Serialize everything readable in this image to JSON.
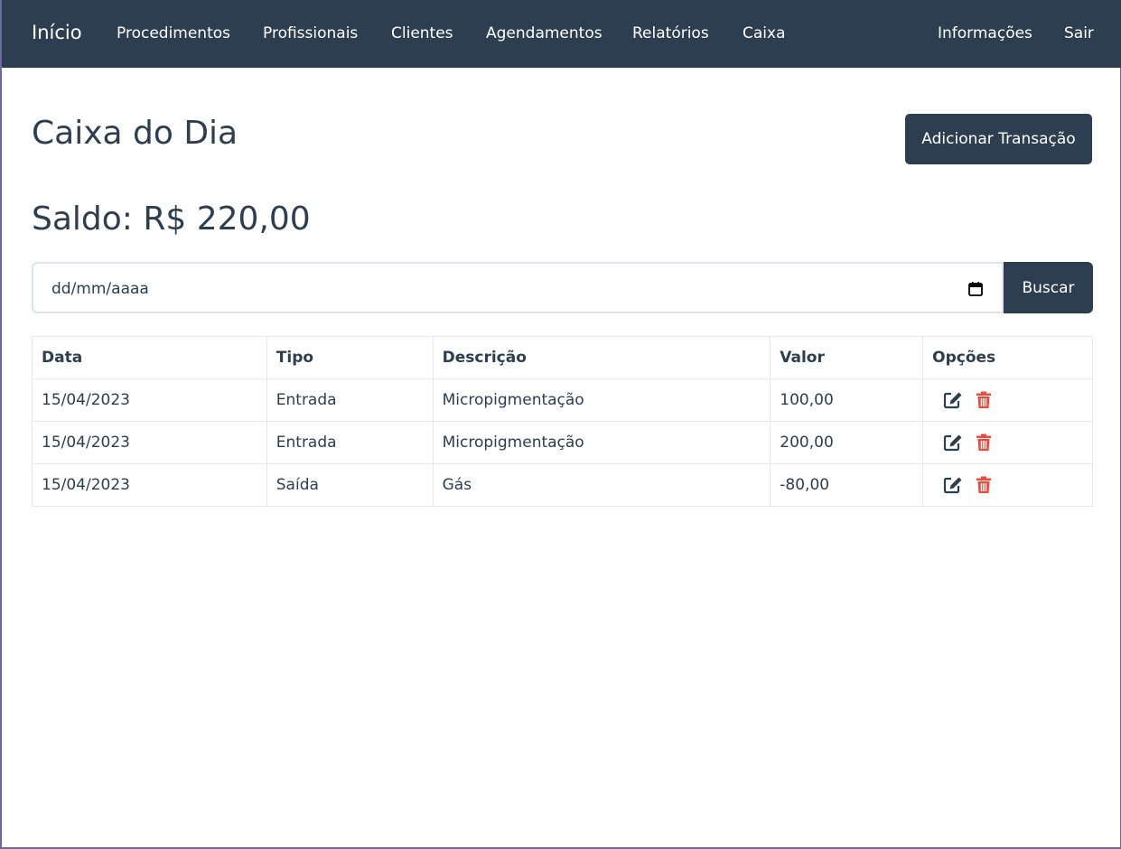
{
  "nav": {
    "brand": "Início",
    "links": [
      "Procedimentos",
      "Profissionais",
      "Clientes",
      "Agendamentos",
      "Relatórios",
      "Caixa"
    ],
    "right": [
      "Informações",
      "Sair"
    ]
  },
  "page": {
    "title": "Caixa do Dia",
    "add_button": "Adicionar Transação",
    "balance": "Saldo: R$ 220,00"
  },
  "filter": {
    "date_placeholder": "dd/mm/aaaa",
    "date_icon": "calendar-icon",
    "search_button": "Buscar"
  },
  "table": {
    "headers": [
      "Data",
      "Tipo",
      "Descrição",
      "Valor",
      "Opções"
    ],
    "rows": [
      {
        "data": "15/04/2023",
        "tipo": "Entrada",
        "descricao": "Micropigmentação",
        "valor": "100,00"
      },
      {
        "data": "15/04/2023",
        "tipo": "Entrada",
        "descricao": "Micropigmentação",
        "valor": "200,00"
      },
      {
        "data": "15/04/2023",
        "tipo": "Saída",
        "descricao": "Gás",
        "valor": "-80,00"
      }
    ],
    "edit_icon": "edit-icon",
    "delete_icon": "trash-icon"
  },
  "colors": {
    "primary": "#2c3e50",
    "danger": "#e74c3c",
    "white": "#ffffff"
  }
}
